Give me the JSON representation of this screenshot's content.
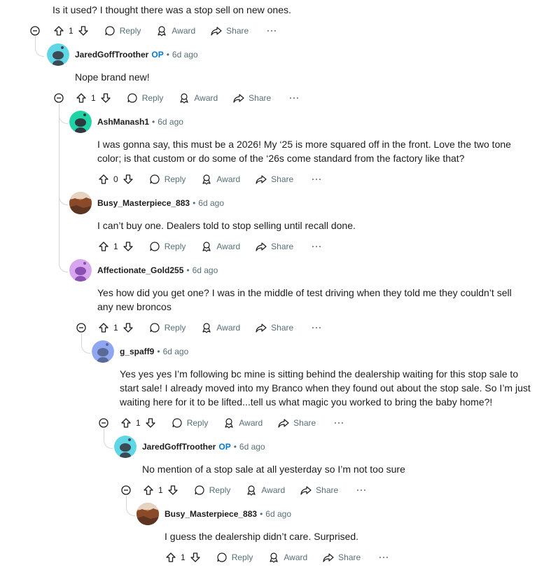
{
  "labels": {
    "reply": "Reply",
    "award": "Award",
    "share": "Share",
    "more": "···",
    "op": "OP",
    "dot": "•"
  },
  "colors": {
    "op": "#0079d3",
    "meta": "#576f76",
    "thread": "#d3d6da"
  },
  "comments": [
    {
      "user": "",
      "op": false,
      "time": "",
      "text": "Is it used? I thought there was a stop sell on new ones.",
      "votes": "1"
    },
    {
      "user": "JaredGoffTroother",
      "op": true,
      "time": "6d ago",
      "text": "Nope brand new!",
      "votes": "1",
      "avatar": "snoo-teal"
    },
    {
      "user": "AshManash1",
      "op": false,
      "time": "6d ago",
      "text": "I was gonna say, this must be a 2026! My ‘25 is more squared off in the front. Love the two tone color; is that custom or do some of the ‘26s come standard from the factory like that?",
      "votes": "0",
      "avatar": "snoo-green"
    },
    {
      "user": "Busy_Masterpiece_883",
      "op": false,
      "time": "6d ago",
      "text": "I can’t buy one. Dealers told to stop selling until recall done.",
      "votes": "1",
      "avatar": "photo-canyon"
    },
    {
      "user": "Affectionate_Gold255",
      "op": false,
      "time": "6d ago",
      "text": "Yes how did you get one? I was in the middle of test driving when they told me they couldn’t sell any new broncos",
      "votes": "1",
      "avatar": "snoo-lavender"
    },
    {
      "user": "g_spaff9",
      "op": false,
      "time": "6d ago",
      "text": "Yes yes yes I’m following bc mine is sitting behind the dealership waiting for this stop sale to start sale! I already moved into my Branco when they found out about the stop sale. So I’m just waiting here for it to be lifted...tell us what magic you worked to bring the baby home?!",
      "votes": "1",
      "avatar": "snoo-periwinkle"
    },
    {
      "user": "JaredGoffTroother",
      "op": true,
      "time": "6d ago",
      "text": "No mention of a stop sale at all yesterday so I’m not too sure",
      "votes": "1",
      "avatar": "snoo-teal"
    },
    {
      "user": "Busy_Masterpiece_883",
      "op": false,
      "time": "6d ago",
      "text": "I guess the dealership didn’t care. Surprised.",
      "votes": "1",
      "avatar": "photo-canyon"
    }
  ]
}
